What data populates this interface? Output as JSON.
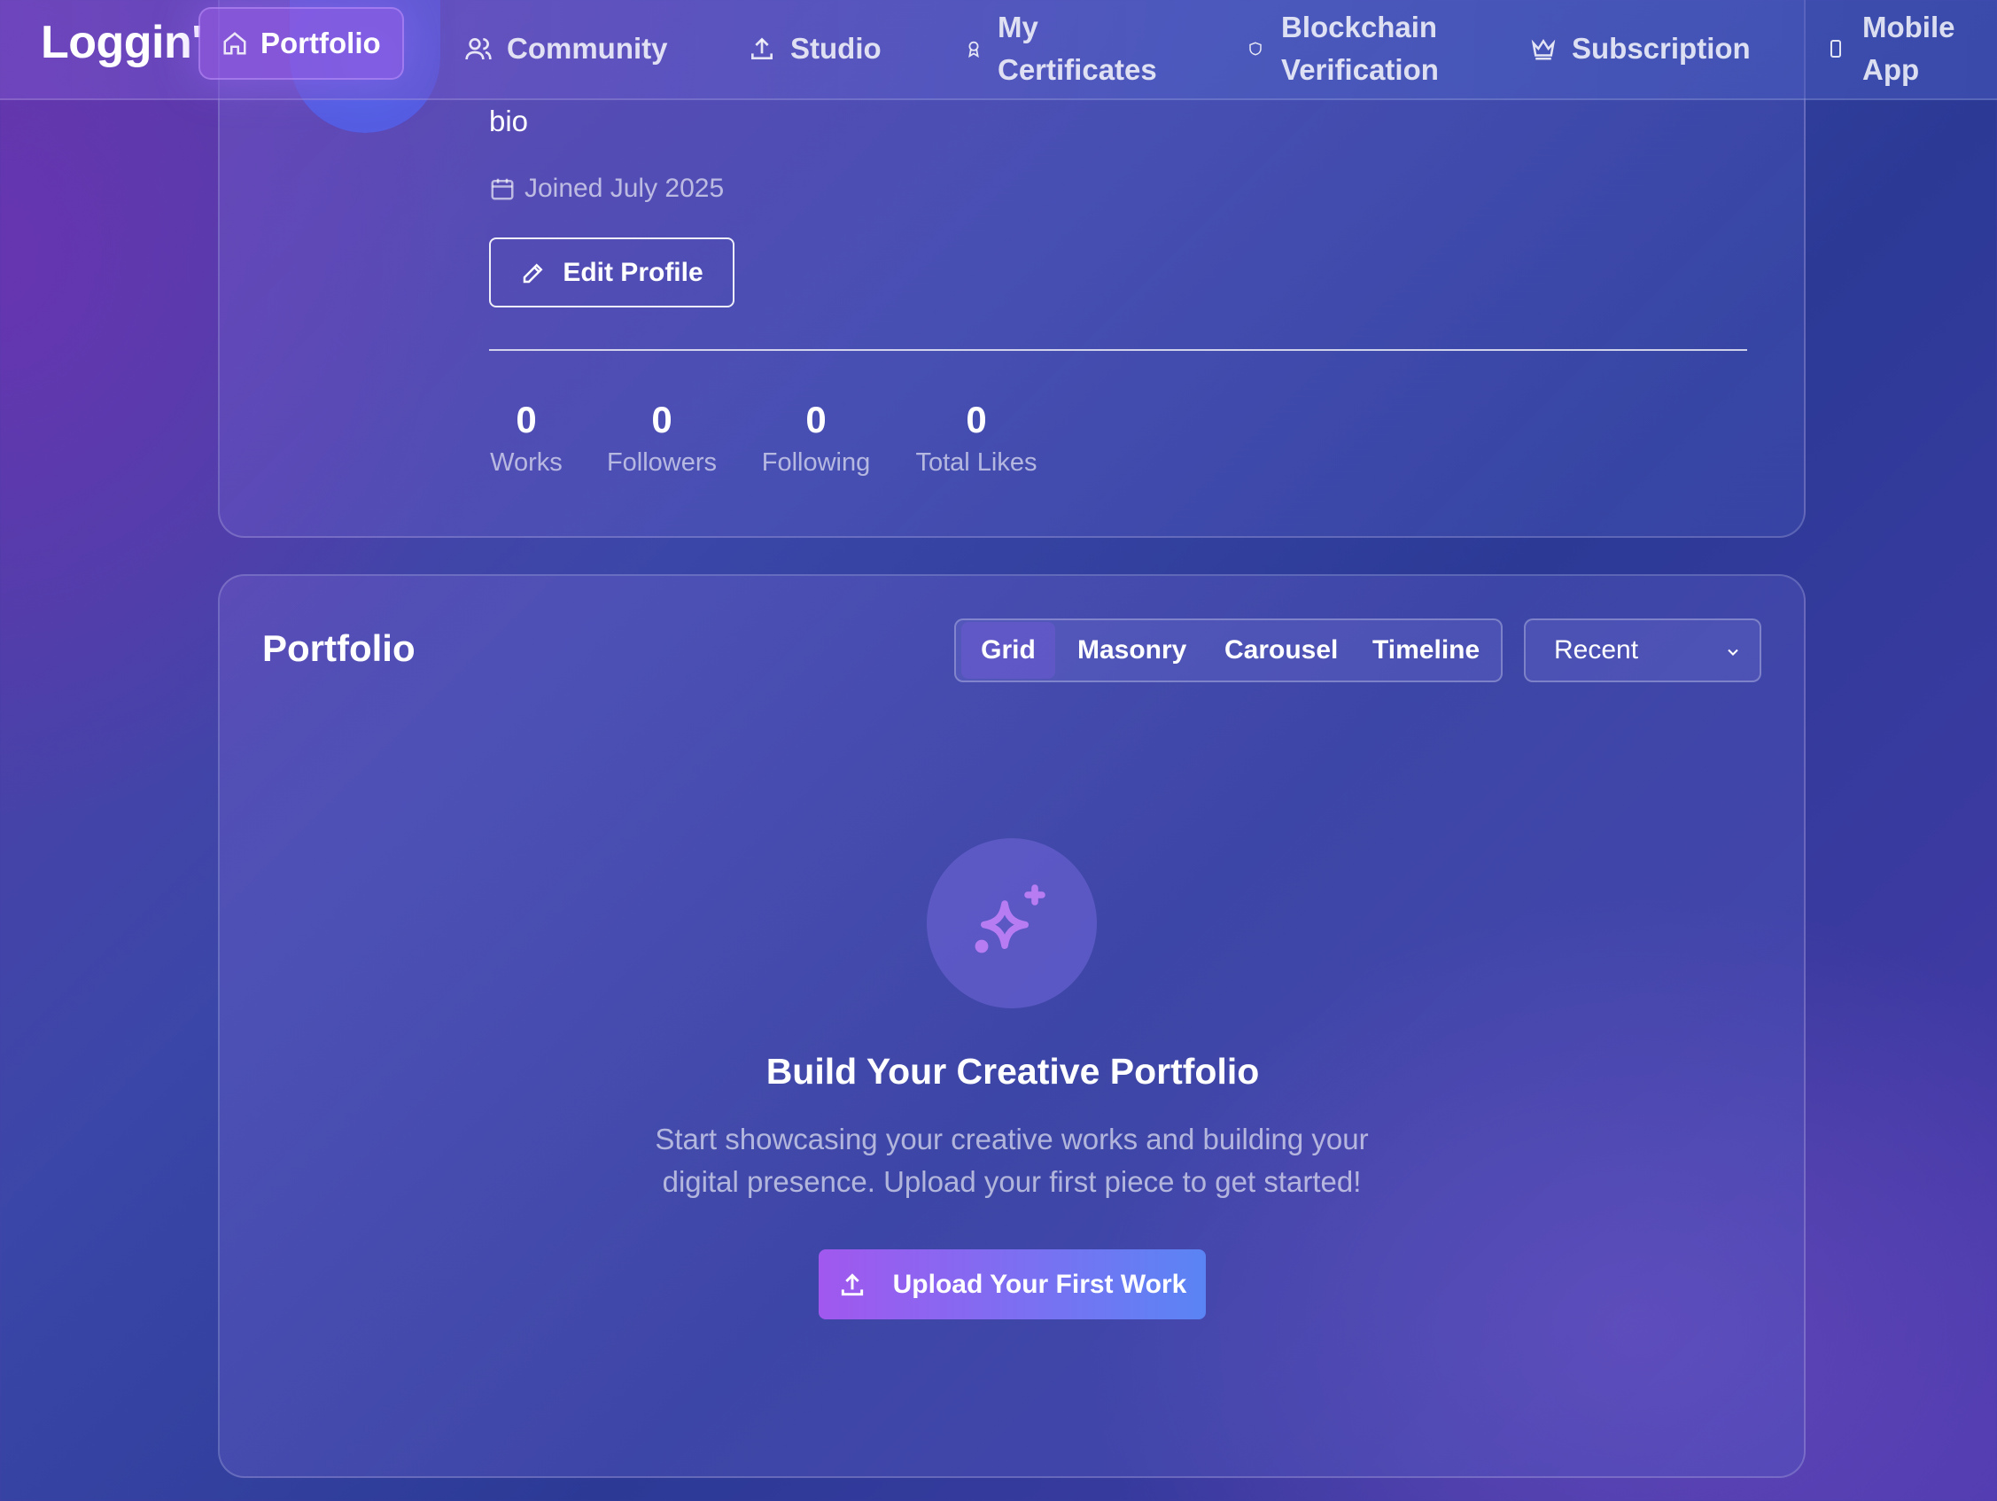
{
  "nav": {
    "logo": "Loggin'",
    "items": [
      {
        "label": "Portfolio",
        "icon": "home-icon",
        "active": true
      },
      {
        "label": "Community",
        "icon": "users-icon"
      },
      {
        "label": "Studio",
        "icon": "upload-icon"
      },
      {
        "label_line1": "My",
        "label_line2": "Certificates",
        "icon": "award-icon"
      },
      {
        "label_line1": "Blockchain",
        "label_line2": "Verification",
        "icon": "shield-icon"
      },
      {
        "label": "Subscription",
        "icon": "crown-icon"
      },
      {
        "label_line1": "Mobile",
        "label_line2": "App",
        "icon": "smartphone-icon"
      }
    ]
  },
  "profile": {
    "bio": "bio",
    "joined": "Joined July 2025",
    "edit_label": "Edit Profile",
    "stats": [
      {
        "value": "0",
        "label": "Works"
      },
      {
        "value": "0",
        "label": "Followers"
      },
      {
        "value": "0",
        "label": "Following"
      },
      {
        "value": "0",
        "label": "Total Likes"
      }
    ]
  },
  "portfolio": {
    "title": "Portfolio",
    "view_tabs": [
      "Grid",
      "Masonry",
      "Carousel",
      "Timeline"
    ],
    "active_view": "Grid",
    "sort_selected": "Recent",
    "empty_icon": "sparkles-icon",
    "empty_title": "Build Your Creative Portfolio",
    "empty_desc_line1": "Start showcasing your creative works and building your",
    "empty_desc_line2": "digital presence. Upload your first piece to get started!",
    "upload_label": "Upload Your First Work"
  },
  "colors": {
    "accent_purple": "#a158ee",
    "accent_blue": "#5a84f4",
    "sparkle": "#b77cf2"
  }
}
